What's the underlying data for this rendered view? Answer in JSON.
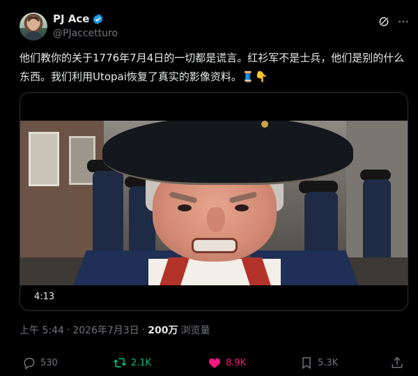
{
  "author": {
    "display_name": "PJ Ace",
    "handle": "@PJaccetturo",
    "verified": true,
    "avatar": "avatar-photo"
  },
  "tweet": {
    "text": "他们教你的关于1776年7月4日的一切都是谎言。红衫军不是士兵，他们是别的什么东西。我们利用Utopai恢复了真实的影像资料。🧵👇"
  },
  "media": {
    "type": "video",
    "duration": "4:13"
  },
  "meta": {
    "time": "上午 5:44",
    "separator1": "·",
    "date": "2026年7月3日",
    "separator2": "·",
    "views_count": "200万",
    "views_label": "浏览量"
  },
  "actions": {
    "reply_count": "530",
    "retweet_count": "2.1K",
    "like_count": "8.9K",
    "bookmark_count": "5.3K"
  },
  "icons": {
    "reply": "reply-icon",
    "retweet": "retweet-icon",
    "like": "heart-icon",
    "bookmark": "bookmark-icon",
    "share": "share-icon",
    "grok": "grok-icon",
    "more": "more-icon",
    "verified": "verified-badge-icon"
  },
  "colors": {
    "background": "#000000",
    "text": "#e7e9ea",
    "muted": "#71767b",
    "retweet_active": "#00ba7c",
    "like_active": "#f91880",
    "verified": "#1d9bf0"
  }
}
